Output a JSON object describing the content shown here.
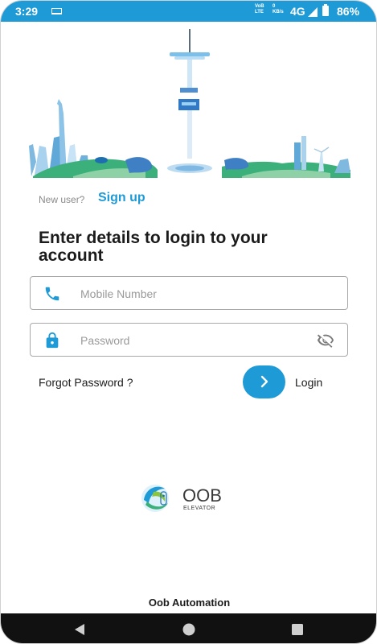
{
  "status_bar": {
    "time": "3:29",
    "volte_line1": "VoB",
    "volte_line2": "LTE",
    "speed_line1": "0",
    "speed_line2": "KB/s",
    "network": "4G",
    "battery": "86%"
  },
  "signup_row": {
    "prompt": "New user?",
    "link": "Sign up"
  },
  "heading": "Enter details to login to your account",
  "form": {
    "mobile_placeholder": "Mobile Number",
    "mobile_value": "",
    "password_placeholder": "Password",
    "password_value": ""
  },
  "forgot_password": "Forgot Password ?",
  "login_label": "Login",
  "logo": {
    "main": "OOB",
    "sub": "ELEVATOR"
  },
  "footer": "Oob Automation",
  "colors": {
    "accent": "#1e9ad6",
    "ground_green": "#3bb07a",
    "nav_bar": "#111111"
  },
  "icons": [
    "laptop-icon",
    "signal-icon",
    "battery-icon",
    "phone-icon",
    "lock-icon",
    "eye-off-icon",
    "chevron-right-icon",
    "back-icon",
    "home-icon",
    "recents-icon"
  ]
}
